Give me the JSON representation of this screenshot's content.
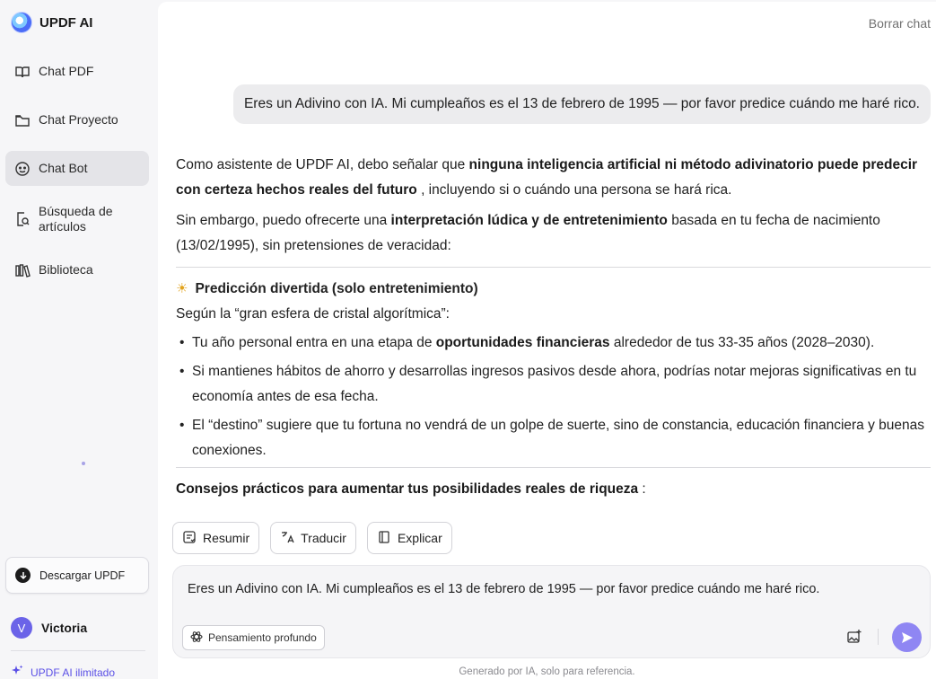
{
  "app": {
    "name": "UPDF AI"
  },
  "sidebar": {
    "items": [
      {
        "label": "Chat PDF",
        "icon": "book-open-icon"
      },
      {
        "label": "Chat Proyecto",
        "icon": "folder-icon"
      },
      {
        "label": "Chat Bot",
        "icon": "bot-face-icon",
        "active": true
      },
      {
        "label": "Búsqueda de artículos",
        "icon": "document-search-icon"
      },
      {
        "label": "Biblioteca",
        "icon": "library-books-icon"
      }
    ],
    "download_label": "Descargar UPDF",
    "user": {
      "initial": "V",
      "name": "Victoria"
    },
    "plan_label": "UPDF AI ilimitado",
    "accent_color": "#5b50e6"
  },
  "main": {
    "clear_chat": "Borrar chat",
    "user_message": "Eres un Adivino con IA. Mi cumpleaños es el 13 de febrero de 1995 — por favor predice cuándo me haré rico.",
    "answer": {
      "p1_a": "Como asistente de UPDF AI, debo señalar que ",
      "p1_b": "ninguna inteligencia artificial ni método adivinatorio puede predecir con certeza hechos reales del futuro",
      "p1_c": " , incluyendo si o cuándo una persona se hará rica.",
      "p2_a": "Sin embargo, puedo ofrecerte una ",
      "p2_b": "interpretación lúdica y de entretenimiento",
      "p2_c": " basada en tu fecha de nacimiento (13/02/1995), sin pretensiones de veracidad:",
      "heading": "Predicción divertida (solo entretenimiento)",
      "intro": "Según la “gran esfera de cristal algorítmica”:",
      "bullet1_a": "Tu año personal entra en una etapa de ",
      "bullet1_b": "oportunidades financieras",
      "bullet1_c": " alrededor de tus 33-35 años (2028–2030).",
      "bullet2": "Si mantienes hábitos de ahorro y desarrollas ingresos pasivos desde ahora, podrías notar mejoras significativas en tu economía antes de esa fecha.",
      "bullet3": "El “destino” sugiere que tu fortuna no vendrá de un golpe de suerte, sino de constancia, educación financiera y buenas conexiones.",
      "tips_bold": "Consejos prácticos para aumentar tus posibilidades reales de riqueza",
      "tips_tail": " :"
    },
    "tools": {
      "summarize": "Resumir",
      "translate": "Traducir",
      "explain": "Explicar"
    },
    "composer": {
      "text": "Eres un Adivino con IA. Mi cumpleaños es el 13 de febrero de 1995 — por favor predice cuándo me haré rico.",
      "deep_thinking": "Pensamiento profundo",
      "send_color": "#8f86f3"
    },
    "footer_note": "Generado por IA, solo para referencia."
  }
}
